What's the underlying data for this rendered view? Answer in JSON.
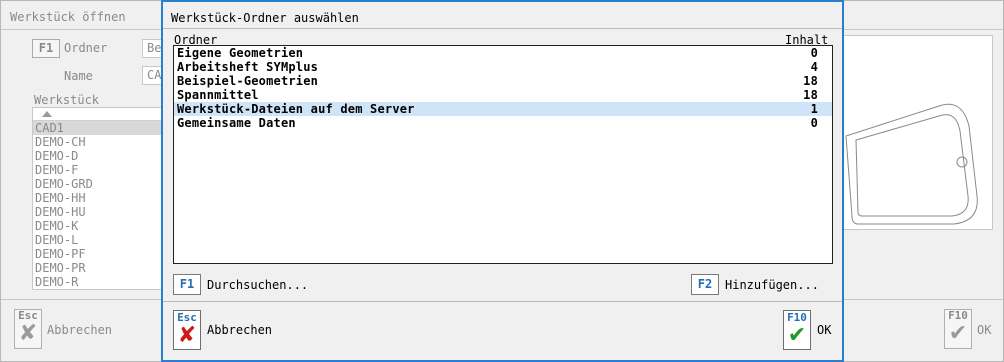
{
  "background_window": {
    "title": "Werkstück öffnen",
    "f1_key": "F1",
    "f1_label": "Ordner",
    "folder_field_value": "Be",
    "name_label": "Name",
    "name_field_value": "CA",
    "list_header": "Werkstück",
    "list_items": [
      "CAD1",
      "DEMO-CH",
      "DEMO-D",
      "DEMO-F",
      "DEMO-GRD",
      "DEMO-HH",
      "DEMO-HU",
      "DEMO-K",
      "DEMO-L",
      "DEMO-PF",
      "DEMO-PR",
      "DEMO-R"
    ],
    "selected_item": "CAD1",
    "cancel_key": "Esc",
    "cancel_label": "Abbrechen",
    "ok_key": "F10",
    "ok_label": "OK"
  },
  "dialog": {
    "title": "Werkstück-Ordner auswählen",
    "columns": {
      "folder": "Ordner",
      "content": "Inhalt"
    },
    "rows": [
      {
        "name": "Eigene Geometrien",
        "count": "0",
        "selected": false
      },
      {
        "name": "Arbeitsheft SYMplus",
        "count": "4",
        "selected": false
      },
      {
        "name": "Beispiel-Geometrien",
        "count": "18",
        "selected": false
      },
      {
        "name": "Spannmittel",
        "count": "18",
        "selected": false
      },
      {
        "name": "Werkstück-Dateien auf dem Server",
        "count": "1",
        "selected": true
      },
      {
        "name": "Gemeinsame Daten",
        "count": "0",
        "selected": false
      }
    ],
    "browse": {
      "key": "F1",
      "label": "Durchsuchen..."
    },
    "add": {
      "key": "F2",
      "label": "Hinzufügen..."
    },
    "cancel": {
      "key": "Esc",
      "label": "Abbrechen",
      "icon": "red-x-icon"
    },
    "ok": {
      "key": "F10",
      "label": "OK",
      "icon": "green-check-icon"
    }
  },
  "colors": {
    "accent": "#2a7ed0",
    "selection": "#cfe4f8",
    "key_text": "#2070b8"
  }
}
